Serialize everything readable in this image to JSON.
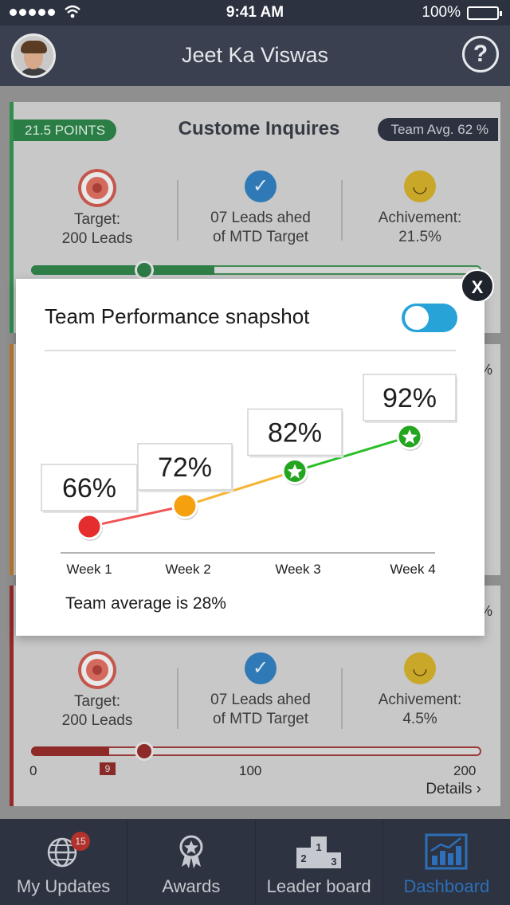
{
  "status_bar": {
    "time": "9:41 AM",
    "battery": "100%"
  },
  "header": {
    "user_name": "Jeet Ka Viswas"
  },
  "cards": [
    {
      "points": "21.5 POINTS",
      "title": "Custome Inquires",
      "team_avg": "Team Avg. 62 %",
      "target": [
        "Target:",
        "200 Leads"
      ],
      "leads": [
        "07 Leads ahed",
        "of MTD Target"
      ],
      "achievement": [
        "Achivement:",
        "21.5%"
      ],
      "progress": 0.43
    },
    {
      "edge_text": "%"
    },
    {
      "edge_text": "%",
      "target": [
        "Target:",
        "200 Leads"
      ],
      "leads": [
        "07 Leads ahed",
        "of MTD Target"
      ],
      "achievement": [
        "Achivement:",
        "4.5%"
      ],
      "progress": 0.17,
      "scale_min": "0",
      "scale_mid": "100",
      "scale_max": "200",
      "marker": "9",
      "details": "Details ›"
    }
  ],
  "modal": {
    "title": "Team Performance snapshot",
    "toggle_on": true,
    "close": "X",
    "footer": "Team average is 28%"
  },
  "chart_data": {
    "type": "line",
    "categories": [
      "Week 1",
      "Week 2",
      "Week 3",
      "Week 4"
    ],
    "values": [
      66,
      72,
      82,
      92
    ],
    "labels": [
      "66%",
      "72%",
      "82%",
      "92%"
    ],
    "point_styles": [
      "red-dot",
      "orange-dot",
      "green-star",
      "green-star"
    ],
    "point_colors": [
      "#e52d2d",
      "#f5a10f",
      "#23a51f",
      "#23a51f"
    ],
    "segment_colors": [
      "#f05454",
      "#f5b533",
      "#2cbf2a"
    ]
  },
  "tabs": [
    {
      "label": "My Updates",
      "badge": "15"
    },
    {
      "label": "Awards"
    },
    {
      "label": "Leader board"
    },
    {
      "label": "Dashboard",
      "active": true
    }
  ]
}
